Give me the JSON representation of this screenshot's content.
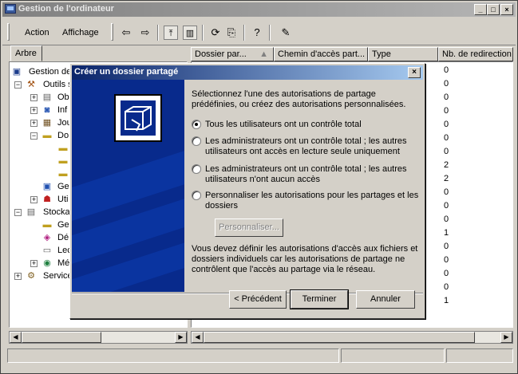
{
  "window": {
    "title": "Gestion de l'ordinateur"
  },
  "menu": {
    "action": "Action",
    "affichage": "Affichage"
  },
  "tabs": {
    "arbre": "Arbre"
  },
  "columns": [
    "Dossier par...",
    "Chemin d'accès part...",
    "Type",
    "Nb. de redirection"
  ],
  "tree": [
    {
      "label": "Gestion de",
      "expander": "−",
      "icon": "computer-management-icon"
    },
    {
      "label": "Outils s",
      "expander": "−",
      "icon": "tools-icon"
    },
    {
      "label": "Ob",
      "expander": "+",
      "icon": "event-viewer-icon"
    },
    {
      "label": "Inf",
      "expander": "+",
      "icon": "system-info-icon"
    },
    {
      "label": "Jou",
      "expander": "+",
      "icon": "logs-icon"
    },
    {
      "label": "Do",
      "expander": "−",
      "icon": "shared-folders-icon"
    },
    {
      "label": "",
      "expander": "",
      "icon": "folder-icon"
    },
    {
      "label": "",
      "expander": "",
      "icon": "folder-icon"
    },
    {
      "label": "",
      "expander": "",
      "icon": "folder-icon"
    },
    {
      "label": "Ge",
      "expander": "",
      "icon": "device-manager-icon"
    },
    {
      "label": "Uti",
      "expander": "+",
      "icon": "users-icon"
    },
    {
      "label": "Stocka",
      "expander": "−",
      "icon": "storage-icon"
    },
    {
      "label": "Ge",
      "expander": "",
      "icon": "folder-icon"
    },
    {
      "label": "Dé",
      "expander": "",
      "icon": "defrag-icon"
    },
    {
      "label": "Lec",
      "expander": "",
      "icon": "drive-icon"
    },
    {
      "label": "Mé",
      "expander": "+",
      "icon": "removable-storage-icon"
    },
    {
      "label": "Service",
      "expander": "+",
      "icon": "services-icon"
    }
  ],
  "redirection_counts": [
    "0",
    "0",
    "0",
    "0",
    "0",
    "0",
    "0",
    "2",
    "2",
    "0",
    "0",
    "0",
    "1",
    "0",
    "0",
    "0",
    "0",
    "1"
  ],
  "dialog": {
    "title": "Créer un dossier partagé",
    "intro": "Sélectionnez l'une des autorisations de partage prédéfinies, ou créez des autorisations personnalisées.",
    "options": [
      {
        "label": "Tous les utilisateurs ont un contrôle total",
        "selected": true
      },
      {
        "label": "Les administrateurs ont un contrôle total ; les autres utilisateurs ont accès en lecture seule uniquement",
        "selected": false
      },
      {
        "label": "Les administrateurs ont un contrôle total ; les autres utilisateurs n'ont aucun accès",
        "selected": false
      },
      {
        "label": "Personnaliser les autorisations pour les partages et les dossiers",
        "selected": false
      }
    ],
    "customize_button": "Personnaliser...",
    "note": "Vous devez définir les autorisations d'accès aux fichiers et dossiers individuels car les autorisations de partage ne contrôlent que l'accès au partage via le réseau.",
    "back_button": "< Précédent",
    "finish_button": "Terminer",
    "cancel_button": "Annuler"
  },
  "colors": {
    "dialog_title_start": "#0a246a",
    "dialog_title_end": "#a6caf0",
    "wizard_art": "#082a8c",
    "face": "#d4d0c8"
  }
}
